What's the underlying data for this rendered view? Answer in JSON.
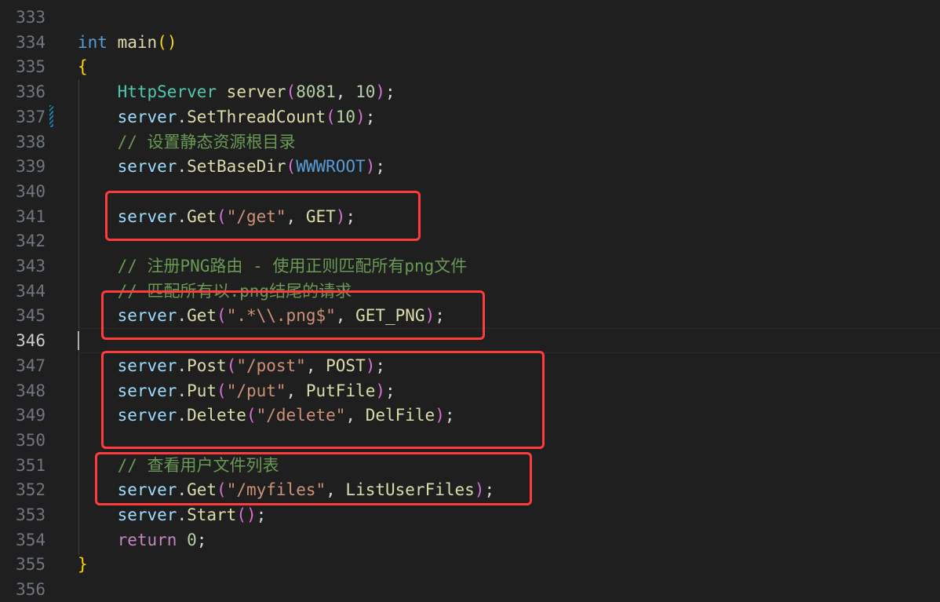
{
  "editor": {
    "active_line": "346",
    "lines": [
      {
        "n": "333",
        "tokens": []
      },
      {
        "n": "334",
        "tokens": [
          {
            "t": "int",
            "c": "kw"
          },
          {
            "t": " "
          },
          {
            "t": "main",
            "c": "fn"
          },
          {
            "t": "()",
            "c": "b1"
          }
        ]
      },
      {
        "n": "335",
        "tokens": [
          {
            "t": "{",
            "c": "b1"
          }
        ]
      },
      {
        "n": "336",
        "tokens": [
          {
            "t": "    "
          },
          {
            "t": "HttpServer",
            "c": "ty"
          },
          {
            "t": " "
          },
          {
            "t": "server",
            "c": "fn"
          },
          {
            "t": "(",
            "c": "b2"
          },
          {
            "t": "8081",
            "c": "num"
          },
          {
            "t": ", ",
            "c": "p"
          },
          {
            "t": "10",
            "c": "num"
          },
          {
            "t": ")",
            "c": "b2"
          },
          {
            "t": ";",
            "c": "p"
          }
        ]
      },
      {
        "n": "337",
        "tokens": [
          {
            "t": "    "
          },
          {
            "t": "server",
            "c": "var"
          },
          {
            "t": ".",
            "c": "p"
          },
          {
            "t": "SetThreadCount",
            "c": "fn"
          },
          {
            "t": "(",
            "c": "b2"
          },
          {
            "t": "10",
            "c": "num"
          },
          {
            "t": ")",
            "c": "b2"
          },
          {
            "t": ";",
            "c": "p"
          }
        ]
      },
      {
        "n": "338",
        "tokens": [
          {
            "t": "    "
          },
          {
            "t": "// 设置静态资源根目录",
            "c": "cm"
          }
        ]
      },
      {
        "n": "339",
        "tokens": [
          {
            "t": "    "
          },
          {
            "t": "server",
            "c": "var"
          },
          {
            "t": ".",
            "c": "p"
          },
          {
            "t": "SetBaseDir",
            "c": "fn"
          },
          {
            "t": "(",
            "c": "b2"
          },
          {
            "t": "WWWROOT",
            "c": "mac"
          },
          {
            "t": ")",
            "c": "b2"
          },
          {
            "t": ";",
            "c": "p"
          }
        ]
      },
      {
        "n": "340",
        "tokens": []
      },
      {
        "n": "341",
        "tokens": [
          {
            "t": "    "
          },
          {
            "t": "server",
            "c": "var"
          },
          {
            "t": ".",
            "c": "p"
          },
          {
            "t": "Get",
            "c": "fn"
          },
          {
            "t": "(",
            "c": "b2"
          },
          {
            "t": "\"/get\"",
            "c": "str"
          },
          {
            "t": ", ",
            "c": "p"
          },
          {
            "t": "GET",
            "c": "fn"
          },
          {
            "t": ")",
            "c": "b2"
          },
          {
            "t": ";",
            "c": "p"
          }
        ]
      },
      {
        "n": "342",
        "tokens": []
      },
      {
        "n": "343",
        "tokens": [
          {
            "t": "    "
          },
          {
            "t": "// 注册PNG路由 - 使用正则匹配所有png文件",
            "c": "cm"
          }
        ]
      },
      {
        "n": "344",
        "tokens": [
          {
            "t": "    "
          },
          {
            "t": "// 匹配所有以.png结尾的请求",
            "c": "cm"
          }
        ]
      },
      {
        "n": "345",
        "tokens": [
          {
            "t": "    "
          },
          {
            "t": "server",
            "c": "var"
          },
          {
            "t": ".",
            "c": "p"
          },
          {
            "t": "Get",
            "c": "fn"
          },
          {
            "t": "(",
            "c": "b2"
          },
          {
            "t": "\".*\\\\.png$\"",
            "c": "str"
          },
          {
            "t": ", ",
            "c": "p"
          },
          {
            "t": "GET_PNG",
            "c": "fn"
          },
          {
            "t": ")",
            "c": "b2"
          },
          {
            "t": ";",
            "c": "p"
          }
        ]
      },
      {
        "n": "346",
        "tokens": []
      },
      {
        "n": "347",
        "tokens": [
          {
            "t": "    "
          },
          {
            "t": "server",
            "c": "var"
          },
          {
            "t": ".",
            "c": "p"
          },
          {
            "t": "Post",
            "c": "fn"
          },
          {
            "t": "(",
            "c": "b2"
          },
          {
            "t": "\"/post\"",
            "c": "str"
          },
          {
            "t": ", ",
            "c": "p"
          },
          {
            "t": "POST",
            "c": "fn"
          },
          {
            "t": ")",
            "c": "b2"
          },
          {
            "t": ";",
            "c": "p"
          }
        ]
      },
      {
        "n": "348",
        "tokens": [
          {
            "t": "    "
          },
          {
            "t": "server",
            "c": "var"
          },
          {
            "t": ".",
            "c": "p"
          },
          {
            "t": "Put",
            "c": "fn"
          },
          {
            "t": "(",
            "c": "b2"
          },
          {
            "t": "\"/put\"",
            "c": "str"
          },
          {
            "t": ", ",
            "c": "p"
          },
          {
            "t": "PutFile",
            "c": "fn"
          },
          {
            "t": ")",
            "c": "b2"
          },
          {
            "t": ";",
            "c": "p"
          }
        ]
      },
      {
        "n": "349",
        "tokens": [
          {
            "t": "    "
          },
          {
            "t": "server",
            "c": "var"
          },
          {
            "t": ".",
            "c": "p"
          },
          {
            "t": "Delete",
            "c": "fn"
          },
          {
            "t": "(",
            "c": "b2"
          },
          {
            "t": "\"/delete\"",
            "c": "str"
          },
          {
            "t": ", ",
            "c": "p"
          },
          {
            "t": "DelFile",
            "c": "fn"
          },
          {
            "t": ")",
            "c": "b2"
          },
          {
            "t": ";",
            "c": "p"
          }
        ]
      },
      {
        "n": "350",
        "tokens": []
      },
      {
        "n": "351",
        "tokens": [
          {
            "t": "    "
          },
          {
            "t": "// 查看用户文件列表",
            "c": "cm"
          }
        ]
      },
      {
        "n": "352",
        "tokens": [
          {
            "t": "    "
          },
          {
            "t": "server",
            "c": "var"
          },
          {
            "t": ".",
            "c": "p"
          },
          {
            "t": "Get",
            "c": "fn"
          },
          {
            "t": "(",
            "c": "b2"
          },
          {
            "t": "\"/myfiles\"",
            "c": "str"
          },
          {
            "t": ", ",
            "c": "p"
          },
          {
            "t": "ListUserFiles",
            "c": "fn"
          },
          {
            "t": ")",
            "c": "b2"
          },
          {
            "t": ";",
            "c": "p"
          }
        ]
      },
      {
        "n": "353",
        "tokens": [
          {
            "t": "    "
          },
          {
            "t": "server",
            "c": "var"
          },
          {
            "t": ".",
            "c": "p"
          },
          {
            "t": "Start",
            "c": "fn"
          },
          {
            "t": "()",
            "c": "b2"
          },
          {
            "t": ";",
            "c": "p"
          }
        ]
      },
      {
        "n": "354",
        "tokens": [
          {
            "t": "    "
          },
          {
            "t": "return",
            "c": "ctl"
          },
          {
            "t": " "
          },
          {
            "t": "0",
            "c": "num"
          },
          {
            "t": ";",
            "c": "p"
          }
        ]
      },
      {
        "n": "355",
        "tokens": [
          {
            "t": "}",
            "c": "b1"
          }
        ]
      },
      {
        "n": "356",
        "tokens": []
      }
    ]
  },
  "colors": {
    "background": "#1f1f1f",
    "annotation_box": "#ff3b3b",
    "line_number": "#6e7681",
    "keyword": "#569cd6",
    "function": "#dcdcaa",
    "string": "#ce9178",
    "comment": "#6a9955"
  }
}
